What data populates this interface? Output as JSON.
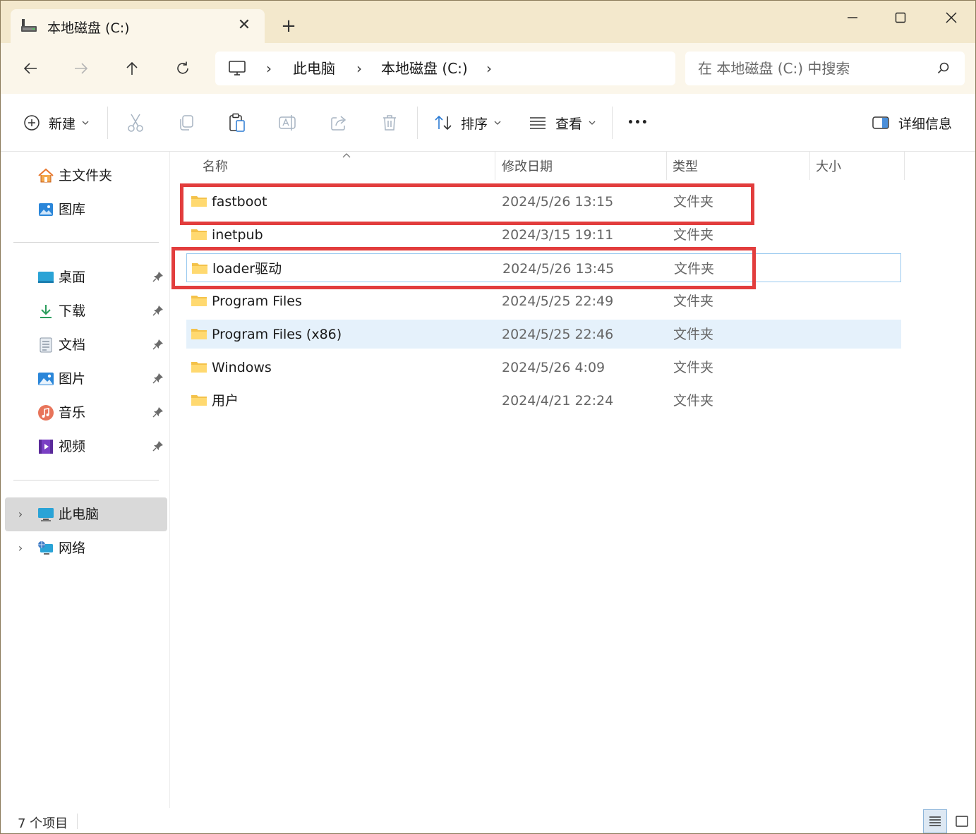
{
  "window": {
    "tab_title": "本地磁盘 (C:)",
    "tab_close_glyph": "✕",
    "new_tab_glyph": "+"
  },
  "address": {
    "breadcrumb": [
      "此电脑",
      "本地磁盘 (C:)"
    ],
    "separator_glyph": "›",
    "search_placeholder": "在 本地磁盘 (C:) 中搜索"
  },
  "toolbar": {
    "new_label": "新建",
    "sort_label": "排序",
    "view_label": "查看",
    "more_glyph": "•••",
    "details_label": "详细信息"
  },
  "sidebar": {
    "home": "主文件夹",
    "gallery": "图库",
    "quick_access": [
      {
        "label": "桌面",
        "icon": "desktop-icon"
      },
      {
        "label": "下载",
        "icon": "download-icon"
      },
      {
        "label": "文档",
        "icon": "document-icon"
      },
      {
        "label": "图片",
        "icon": "pictures-icon"
      },
      {
        "label": "音乐",
        "icon": "music-icon"
      },
      {
        "label": "视频",
        "icon": "video-icon"
      }
    ],
    "this_pc": "此电脑",
    "network": "网络",
    "expand_glyph": "›"
  },
  "columns": {
    "name": "名称",
    "date": "修改日期",
    "type": "类型",
    "size": "大小"
  },
  "files": [
    {
      "name": "fastboot",
      "date": "2024/5/26 13:15",
      "type": "文件夹",
      "size": "",
      "highlighted": true
    },
    {
      "name": "inetpub",
      "date": "2024/3/15 19:11",
      "type": "文件夹",
      "size": ""
    },
    {
      "name": "loader驱动",
      "date": "2024/5/26 13:45",
      "type": "文件夹",
      "size": "",
      "focused": true,
      "highlighted": true
    },
    {
      "name": "Program Files",
      "date": "2024/5/25 22:49",
      "type": "文件夹",
      "size": ""
    },
    {
      "name": "Program Files (x86)",
      "date": "2024/5/25 22:46",
      "type": "文件夹",
      "size": "",
      "selected": true
    },
    {
      "name": "Windows",
      "date": "2024/5/26 4:09",
      "type": "文件夹",
      "size": ""
    },
    {
      "name": "用户",
      "date": "2024/4/21 22:24",
      "type": "文件夹",
      "size": ""
    }
  ],
  "status": {
    "item_count": "7 个项目"
  },
  "colors": {
    "highlight_box": "#e23d3d",
    "selection": "#e5f1fb",
    "folder": "#f4c24a",
    "titlebar": "#f3e8cc"
  }
}
